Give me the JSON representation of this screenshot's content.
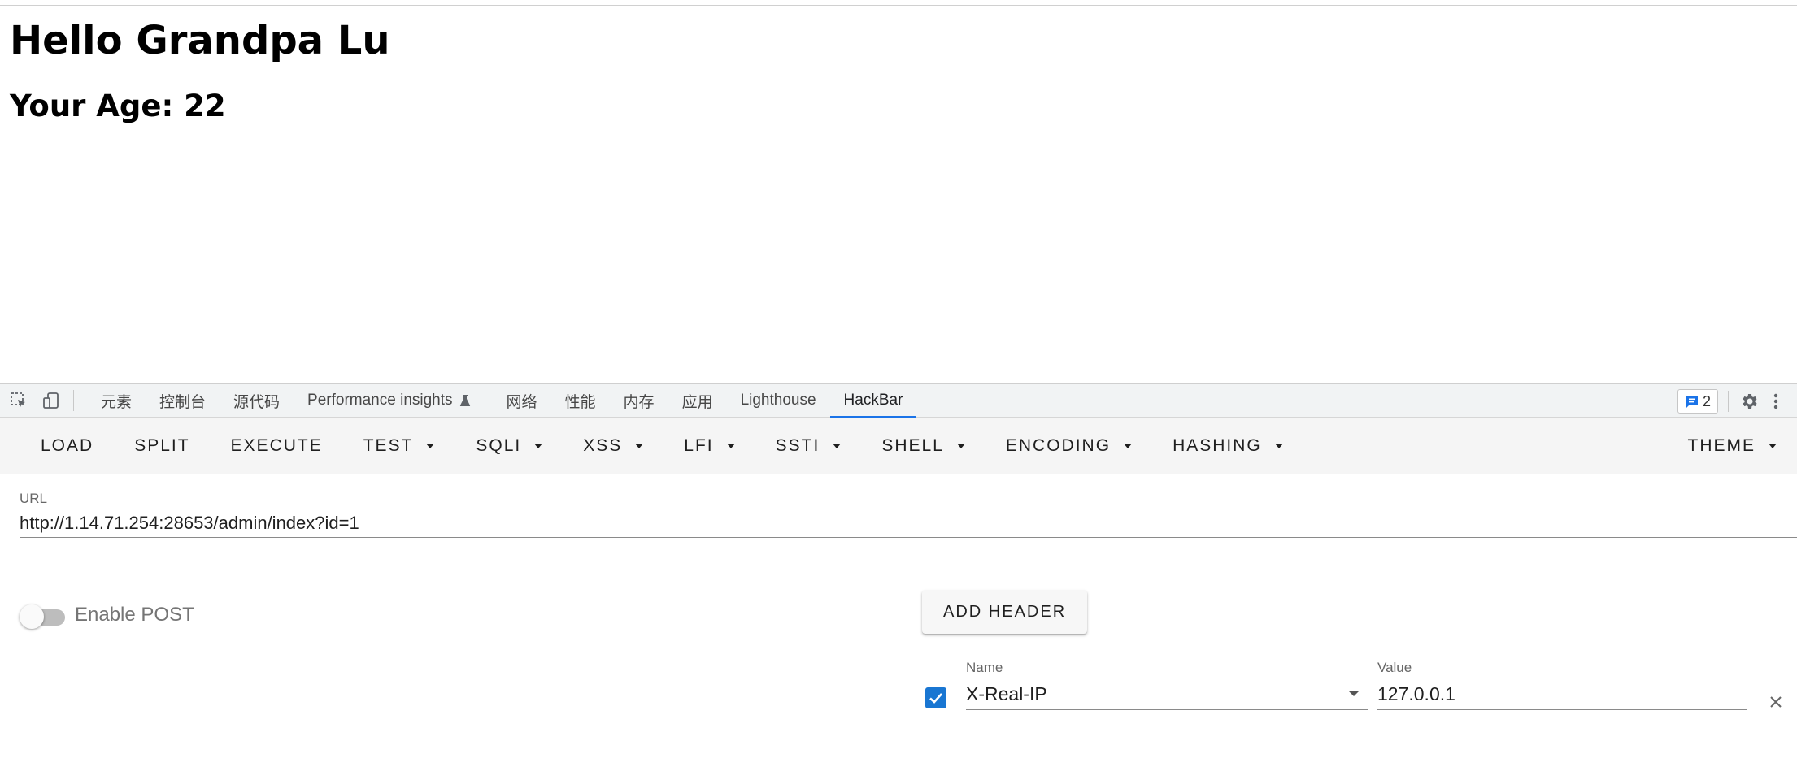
{
  "page": {
    "heading": "Hello Grandpa Lu",
    "age_line": "Your Age: 22"
  },
  "devtools": {
    "tabs": [
      {
        "label": "元素"
      },
      {
        "label": "控制台"
      },
      {
        "label": "源代码"
      },
      {
        "label": "Performance insights"
      },
      {
        "label": "网络"
      },
      {
        "label": "性能"
      },
      {
        "label": "内存"
      },
      {
        "label": "应用"
      },
      {
        "label": "Lighthouse"
      },
      {
        "label": "HackBar"
      }
    ],
    "active_tab": "HackBar",
    "issues_count": "2",
    "accent": "#1a73e8"
  },
  "hackbar": {
    "toolbar": {
      "load": "LOAD",
      "split": "SPLIT",
      "execute": "EXECUTE",
      "test": "TEST",
      "sqli": "SQLI",
      "xss": "XSS",
      "lfi": "LFI",
      "ssti": "SSTI",
      "shell": "SHELL",
      "encoding": "ENCODING",
      "hashing": "HASHING",
      "theme": "THEME"
    },
    "url": {
      "label": "URL",
      "value": "http://1.14.71.254:28653/admin/index?id=1"
    },
    "post": {
      "label": "Enable POST",
      "enabled": false
    },
    "add_header": "ADD HEADER",
    "header_row": {
      "checked": true,
      "name_label": "Name",
      "name_value": "X-Real-IP",
      "value_label": "Value",
      "value_value": "127.0.0.1"
    },
    "checkbox_color": "#1976d2"
  }
}
